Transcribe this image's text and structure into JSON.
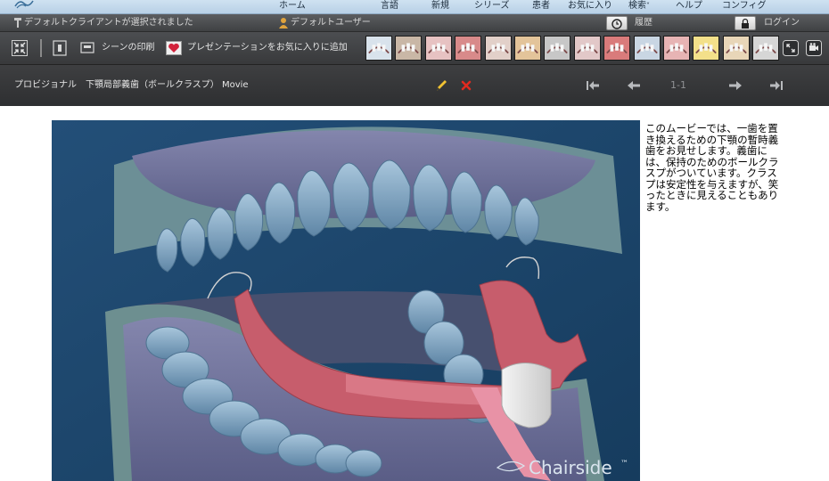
{
  "topnav": {
    "items": [
      "ホーム",
      "言語",
      "新規",
      "シリーズ",
      "患者",
      "お気に入り",
      "検索",
      "ヘルプ",
      "コンフィグ"
    ]
  },
  "status": {
    "client_text": "デフォルトクライアントが選択されました",
    "user_text": "デフォルトユーザー",
    "history_label": "履歴",
    "login_label": "ログイン"
  },
  "toolbar": {
    "print_label": "シーンの印刷",
    "favorite_label": "プレゼンテーションをお気に入りに追加",
    "thumbnails": [
      {
        "name": "bridge",
        "bg": "#d9e3ec"
      },
      {
        "name": "implant",
        "bg": "#c9b7a6"
      },
      {
        "name": "gums",
        "bg": "#e7c2c2"
      },
      {
        "name": "crown",
        "bg": "#d88a8a"
      },
      {
        "name": "smile",
        "bg": "#e2d0c9"
      },
      {
        "name": "roots",
        "bg": "#e3c49a"
      },
      {
        "name": "extraction",
        "bg": "#c7c7c7"
      },
      {
        "name": "lower-arch",
        "bg": "#e2c8c8"
      },
      {
        "name": "upper-arch",
        "bg": "#d97b7b"
      },
      {
        "name": "molars",
        "bg": "#c9d6e3"
      },
      {
        "name": "section",
        "bg": "#e7b4b4"
      },
      {
        "name": "brush",
        "bg": "#f3e08a"
      },
      {
        "name": "denture",
        "bg": "#e8d6b8"
      },
      {
        "name": "tools",
        "bg": "#d6d6d6"
      }
    ]
  },
  "title_bar": {
    "title": "プロビジョナル　下顎局部義歯（ボールクラスプ） Movie",
    "page_indicator": "1-1"
  },
  "movie": {
    "watermark": "Chairside",
    "trademark": "™"
  },
  "description": "このムービーでは、一歯を置き換えるための下顎の暫時義歯をお見せします。義歯には、保持のためのボールクラスプがついています。クラスプは安定性を与えますが、笑ったときに見えることもあります。"
}
